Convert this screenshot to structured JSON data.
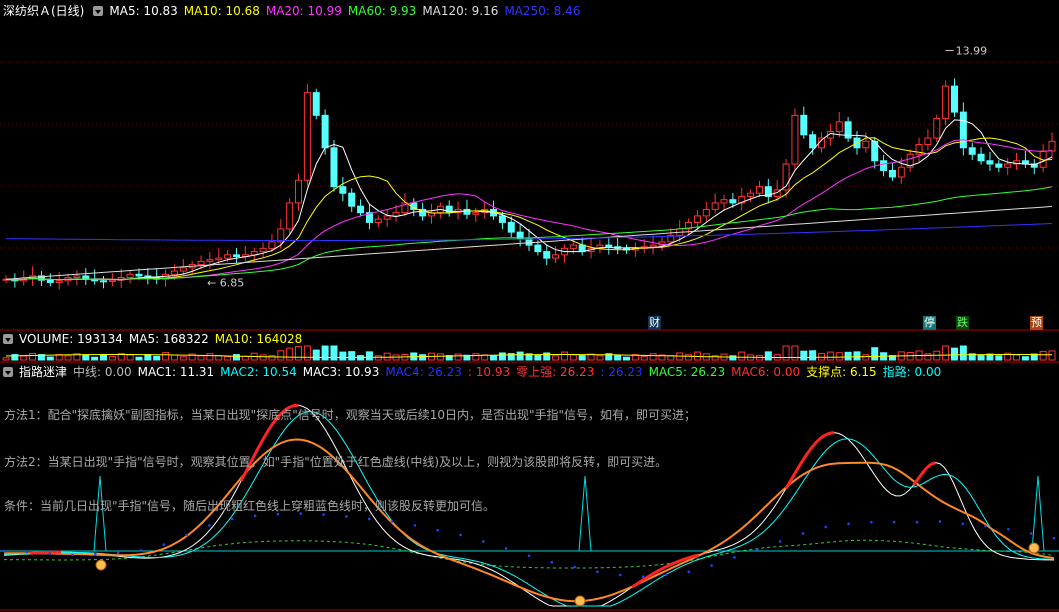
{
  "header": {
    "stock_name": "深纺织Ａ(日线)",
    "ma": [
      {
        "label": "MA5: 10.83",
        "color": "#ffffff"
      },
      {
        "label": "MA10: 10.68",
        "color": "#ffff00"
      },
      {
        "label": "MA20: 10.99",
        "color": "#ff33ff"
      },
      {
        "label": "MA60: 9.93",
        "color": "#33ff33"
      },
      {
        "label": "MA120: 9.16",
        "color": "#dddddd"
      },
      {
        "label": "MA250: 8.46",
        "color": "#3333ff"
      }
    ]
  },
  "volume_header": {
    "items": [
      {
        "label": "VOLUME: 193134",
        "color": "#ffffff"
      },
      {
        "label": "MA5: 168322",
        "color": "#ffffff"
      },
      {
        "label": "MA10: 164028",
        "color": "#ffff00"
      }
    ]
  },
  "indicator_header": {
    "name": "指路迷津",
    "items": [
      {
        "label": "中线: 0.00",
        "color": "#bbbbbb"
      },
      {
        "label": "MAC1: 11.31",
        "color": "#ffffff"
      },
      {
        "label": "MAC2: 10.54",
        "color": "#00ffff"
      },
      {
        "label": "MAC3: 10.93",
        "color": "#ffffff"
      },
      {
        "label": "MAC4: 26.23",
        "color": "#2233ff"
      },
      {
        "label": ": 10.93",
        "color": "#ff3333"
      },
      {
        "label": "零上强: 26.23",
        "color": "#ff3333"
      },
      {
        "label": ": 26.23",
        "color": "#2233ff"
      },
      {
        "label": "MAC5: 26.23",
        "color": "#33ff33"
      },
      {
        "label": "MAC6: 0.00",
        "color": "#ff3333"
      },
      {
        "label": "支撑点: 6.15",
        "color": "#ffff00"
      },
      {
        "label": "指路: 0.00",
        "color": "#00ffff"
      }
    ]
  },
  "methods": [
    "方法1：配合\"探底擒妖\"副图指标，当某日出现\"探底点\"信号时，观察当天或后续10日内，是否出现\"手指\"信号，如有，即可买进；",
    "方法2：当某日出现\"手指\"信号时，观察其位置，如\"手指\"位置处于红色虚线(中线)及以上，则视为该股即将反转，即可买进。",
    "条件：当前几日出现\"手指\"信号，随后出现粗红色线上穿粗蓝色线时，则该股反转更加可信。"
  ],
  "flags": [
    {
      "text": "财",
      "color": "#ffffff",
      "bg": "#113355"
    },
    {
      "text": "停",
      "color": "#ffffff",
      "bg": "#117777"
    },
    {
      "text": "跌",
      "color": "#66ff66",
      "bg": "#114411"
    },
    {
      "text": "预",
      "color": "#ffffff",
      "bg": "#aa4411"
    }
  ],
  "chart_data": {
    "type": "candlestick",
    "price_annotations": {
      "high": "13.99",
      "low": "6.85"
    },
    "ylim": [
      6.0,
      15.0
    ],
    "closes": [
      6.95,
      6.9,
      6.98,
      7.05,
      6.92,
      6.85,
      6.9,
      7.0,
      7.05,
      6.95,
      6.9,
      6.88,
      6.92,
      7.0,
      7.1,
      7.05,
      7.0,
      6.95,
      7.1,
      7.2,
      7.3,
      7.4,
      7.5,
      7.55,
      7.6,
      7.7,
      7.65,
      7.7,
      7.8,
      7.9,
      8.1,
      8.5,
      9.3,
      10.0,
      12.7,
      12.0,
      11.0,
      9.8,
      9.6,
      9.2,
      9.0,
      8.7,
      8.8,
      8.9,
      9.0,
      9.3,
      9.1,
      8.9,
      9.0,
      9.2,
      9.0,
      9.1,
      8.95,
      9.0,
      9.1,
      8.9,
      8.7,
      8.4,
      8.2,
      8.0,
      7.8,
      7.6,
      7.7,
      7.9,
      8.0,
      7.8,
      7.9,
      8.0,
      7.95,
      7.9,
      7.85,
      7.9,
      7.95,
      8.0,
      8.1,
      8.3,
      8.5,
      8.7,
      8.9,
      9.1,
      9.3,
      9.4,
      9.3,
      9.5,
      9.6,
      9.8,
      9.5,
      9.7,
      10.5,
      12.0,
      11.4,
      11.0,
      11.3,
      11.5,
      11.8,
      11.3,
      11.0,
      11.2,
      10.6,
      10.3,
      10.1,
      10.4,
      10.8,
      11.1,
      11.3,
      11.9,
      12.9,
      12.1,
      11.0,
      10.8,
      10.6,
      10.5,
      10.4,
      10.5,
      10.6,
      10.5,
      10.4,
      10.9,
      11.2
    ],
    "series": [
      {
        "name": "MA5",
        "color": "#ffffff"
      },
      {
        "name": "MA10",
        "color": "#ffff00"
      },
      {
        "name": "MA20",
        "color": "#ff33ff"
      },
      {
        "name": "MA60",
        "color": "#33ff33"
      },
      {
        "name": "MA120",
        "color": "#dddddd"
      },
      {
        "name": "MA250",
        "color": "#3333ff"
      }
    ],
    "indicator": {
      "mac4_dots": [
        0.0,
        -0.3,
        -0.8,
        -1.2,
        -1.0,
        -0.6,
        0.2,
        2.0,
        5.0,
        8.0,
        10.0,
        11.0,
        11.5,
        11.7,
        11.4,
        10.8,
        10.0,
        9.2,
        8.0,
        6.5,
        5.0,
        3.0,
        0.8,
        -1.5,
        -3.5,
        -5.0,
        -6.5,
        -7.5,
        -8.0,
        -7.5,
        -6.5,
        -4.5,
        -2.0,
        0.5,
        3.0,
        5.5,
        7.5,
        8.5,
        9.0,
        9.0,
        9.0,
        9.2,
        8.5,
        7.8,
        6.8,
        5.5,
        4.0
      ]
    }
  }
}
